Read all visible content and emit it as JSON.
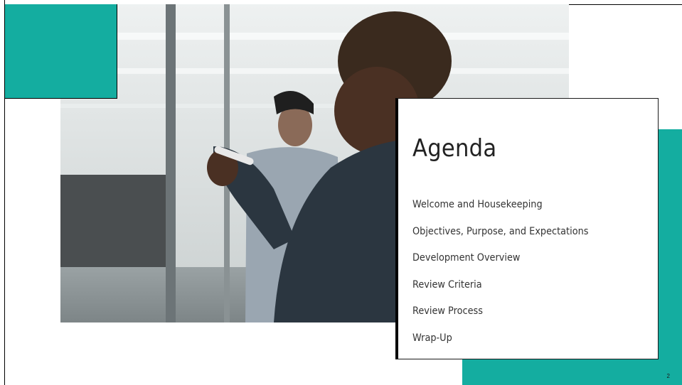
{
  "agenda": {
    "title": "Agenda",
    "items": [
      "Welcome and Housekeeping",
      "Objectives, Purpose, and Expectations",
      "Development Overview",
      "Review Criteria",
      "Review Process",
      "Wrap-Up"
    ]
  },
  "slide": {
    "page_number": "2"
  },
  "colors": {
    "accent_teal": "#14ada0",
    "background": "#ffffff",
    "text": "#333333"
  },
  "photo": {
    "icon": "office-whiteboard-photo"
  }
}
